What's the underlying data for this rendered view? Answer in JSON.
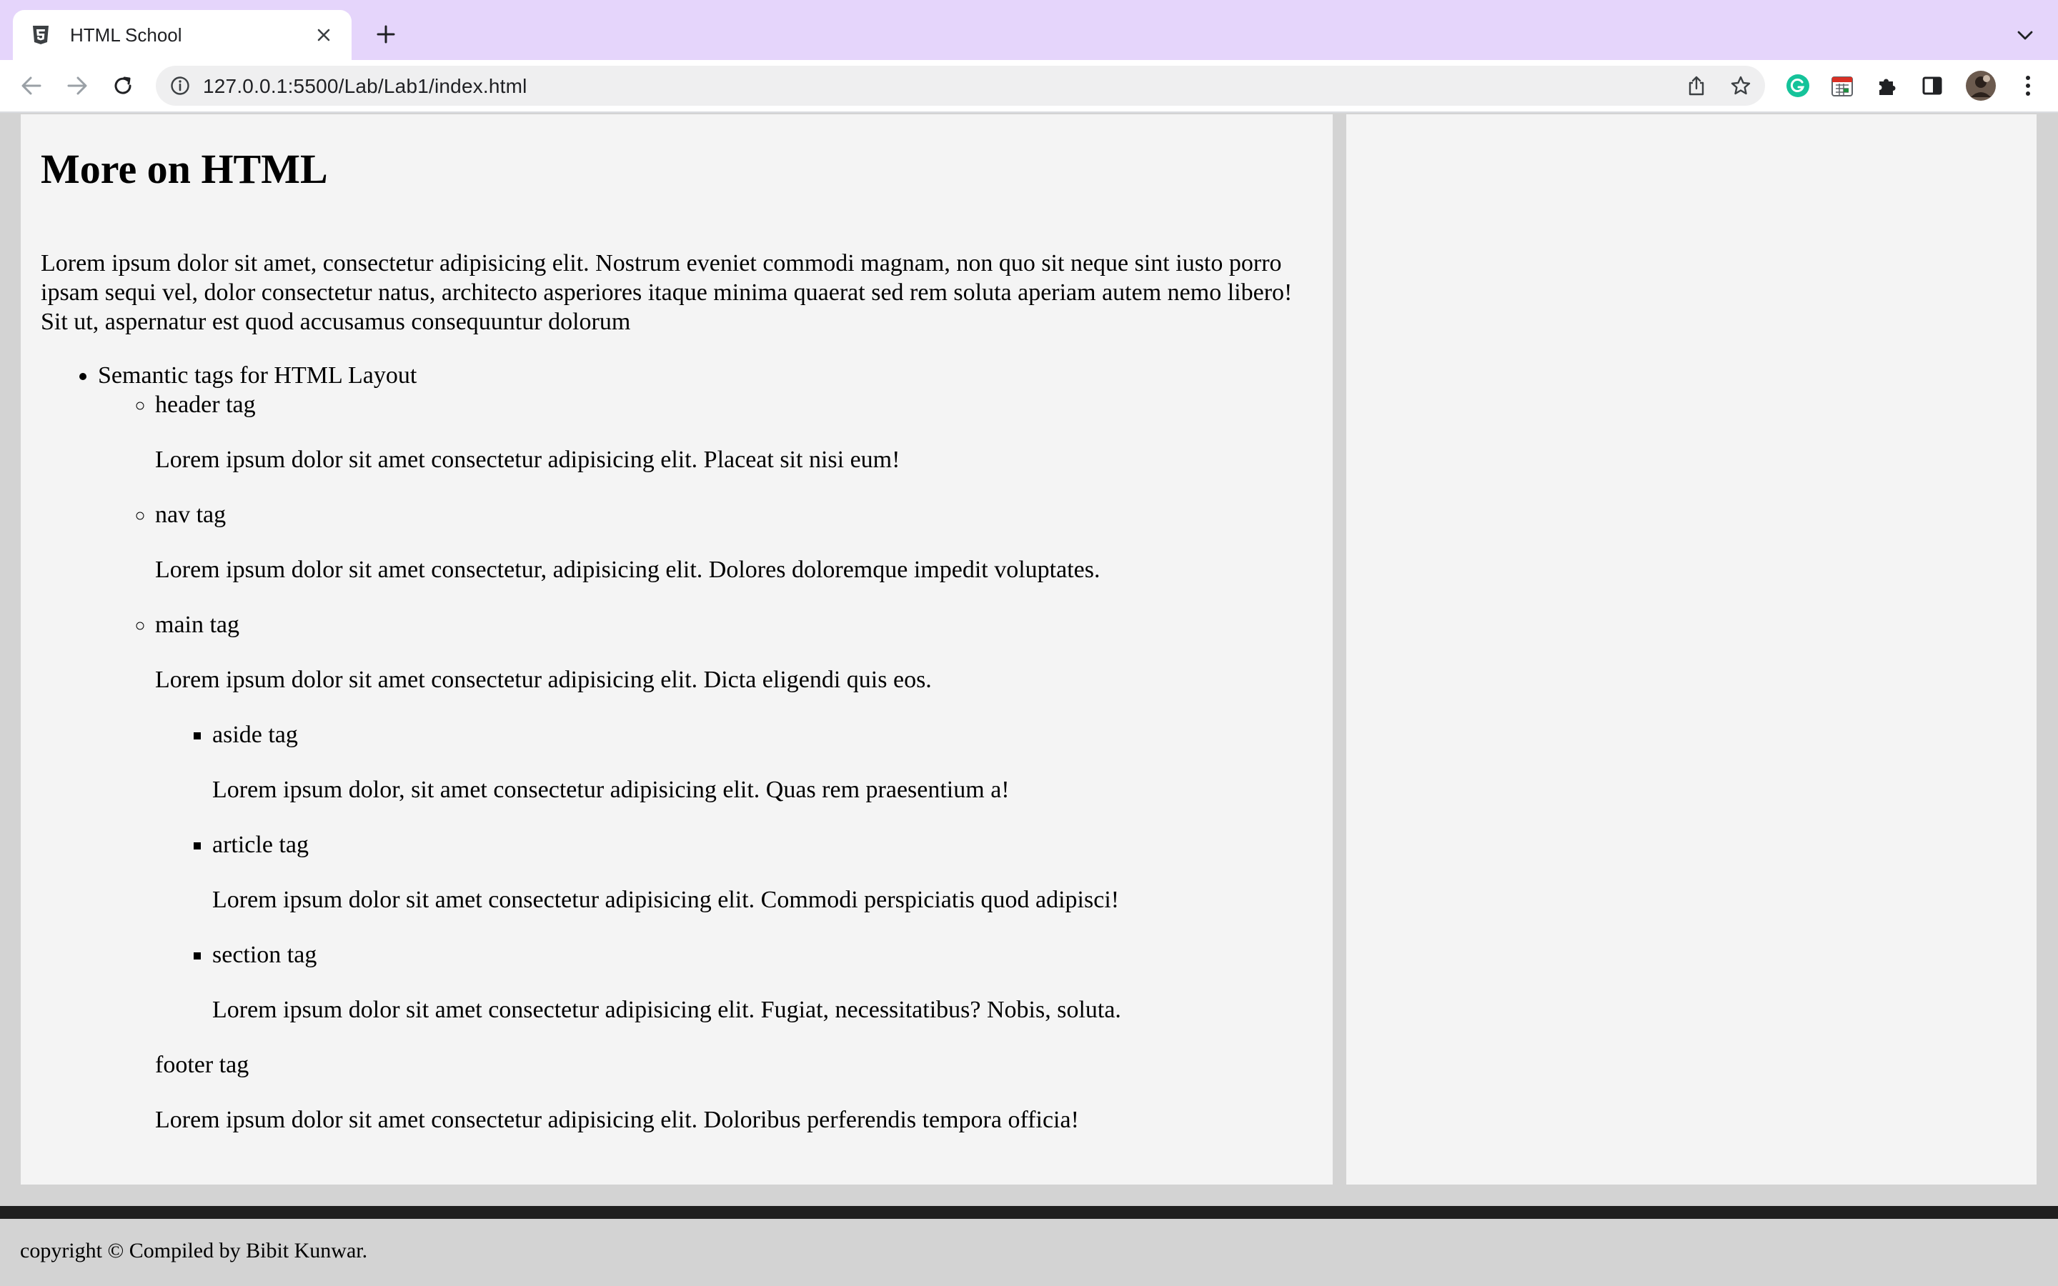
{
  "browser": {
    "tab_title": "HTML School",
    "url": "127.0.0.1:5500/Lab/Lab1/index.html",
    "colors": {
      "tabstrip": "#e5d5fb",
      "toolbar": "#ffffff",
      "omnibox": "#efeff0"
    },
    "icons": [
      "html5-icon",
      "close-icon",
      "plus-icon",
      "chevron-down-icon",
      "back-arrow-icon",
      "forward-arrow-icon",
      "reload-icon",
      "info-icon",
      "share-icon",
      "star-icon",
      "grammarly-icon",
      "calendar-icon",
      "puzzle-icon",
      "side-panel-icon",
      "avatar"
    ]
  },
  "content": {
    "title": "More on HTML",
    "intro": "Lorem ipsum dolor sit amet, consectetur adipisicing elit. Nostrum eveniet commodi magnam, non quo sit neque sint iusto porro ipsam sequi vel, dolor consectetur natus, architecto asperiores itaque minima quaerat sed rem soluta aperiam autem nemo libero! Sit ut, aspernatur est quod accusamus consequuntur dolorum",
    "list_heading": "Semantic tags for HTML Layout",
    "items": [
      {
        "label": "header tag",
        "desc": "Lorem ipsum dolor sit amet consectetur adipisicing elit. Placeat sit nisi eum!"
      },
      {
        "label": "nav tag",
        "desc": "Lorem ipsum dolor sit amet consectetur, adipisicing elit. Dolores doloremque impedit voluptates."
      },
      {
        "label": "main tag",
        "desc": "Lorem ipsum dolor sit amet consectetur adipisicing elit. Dicta eligendi quis eos."
      }
    ],
    "sub_items": [
      {
        "label": "aside tag",
        "desc": "Lorem ipsum dolor, sit amet consectetur adipisicing elit. Quas rem praesentium a!"
      },
      {
        "label": "article tag",
        "desc": "Lorem ipsum dolor sit amet consectetur adipisicing elit. Commodi perspiciatis quod adipisci!"
      },
      {
        "label": "section tag",
        "desc": "Lorem ipsum dolor sit amet consectetur adipisicing elit. Fugiat, necessitatibus? Nobis, soluta."
      }
    ],
    "footer_item": {
      "label": "footer tag",
      "desc": "Lorem ipsum dolor sit amet consectetur adipisicing elit. Doloribus perferendis tempora officia!"
    }
  },
  "footer": {
    "copyright": "copyright © Compiled by Bibit Kunwar."
  }
}
